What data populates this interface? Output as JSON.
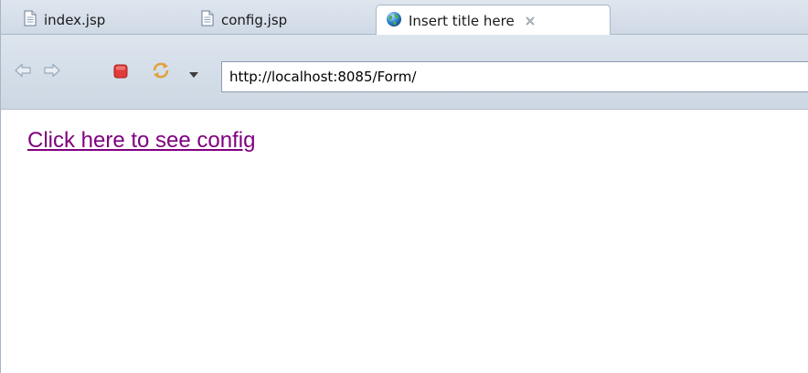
{
  "tabs": [
    {
      "label": "index.jsp",
      "icon": "jsp-file-icon",
      "active": false
    },
    {
      "label": "config.jsp",
      "icon": "jsp-file-icon",
      "active": false
    },
    {
      "label": "Insert title here",
      "icon": "globe-icon",
      "active": true
    }
  ],
  "toolbar": {
    "url": "http://localhost:8085/Form/"
  },
  "content": {
    "link_text": "Click here to see config"
  },
  "colors": {
    "visited_link": "#800080",
    "stop_red": "#e03a3a"
  }
}
